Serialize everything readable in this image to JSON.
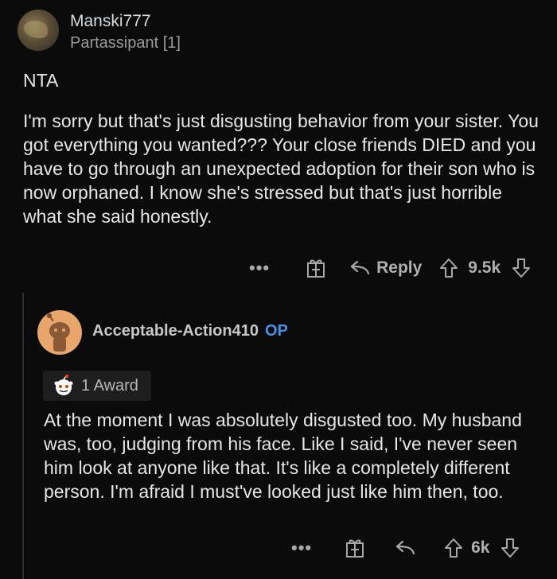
{
  "comment1": {
    "username": "Manski777",
    "flair": "Partassipant [1]",
    "verdict": "NTA",
    "body": "I'm sorry but that's just disgusting behavior from your sister. You got everything you wanted??? Your close friends DIED and you have to go through an unexpected adoption for their son who is now orphaned. I know she's stressed but that's just horrible what she said honestly.",
    "actions": {
      "more": "•••",
      "reply_label": "Reply",
      "score": "9.5k"
    }
  },
  "comment2": {
    "username": "Acceptable-Action410",
    "op_tag": "OP",
    "award_label": "1 Award",
    "body": "At the moment I was absolutely disgusted too. My husband was, too, judging from his face. Like I said, I've never seen him look at anyone like that. It's like a completely different person. I'm afraid I must've looked just like him then, too.",
    "actions": {
      "more": "•••",
      "score": "6k"
    }
  },
  "colors": {
    "background": "#0b0b0b",
    "op_blue": "#4a90e2",
    "avatar_orange": "#e8a66b"
  }
}
